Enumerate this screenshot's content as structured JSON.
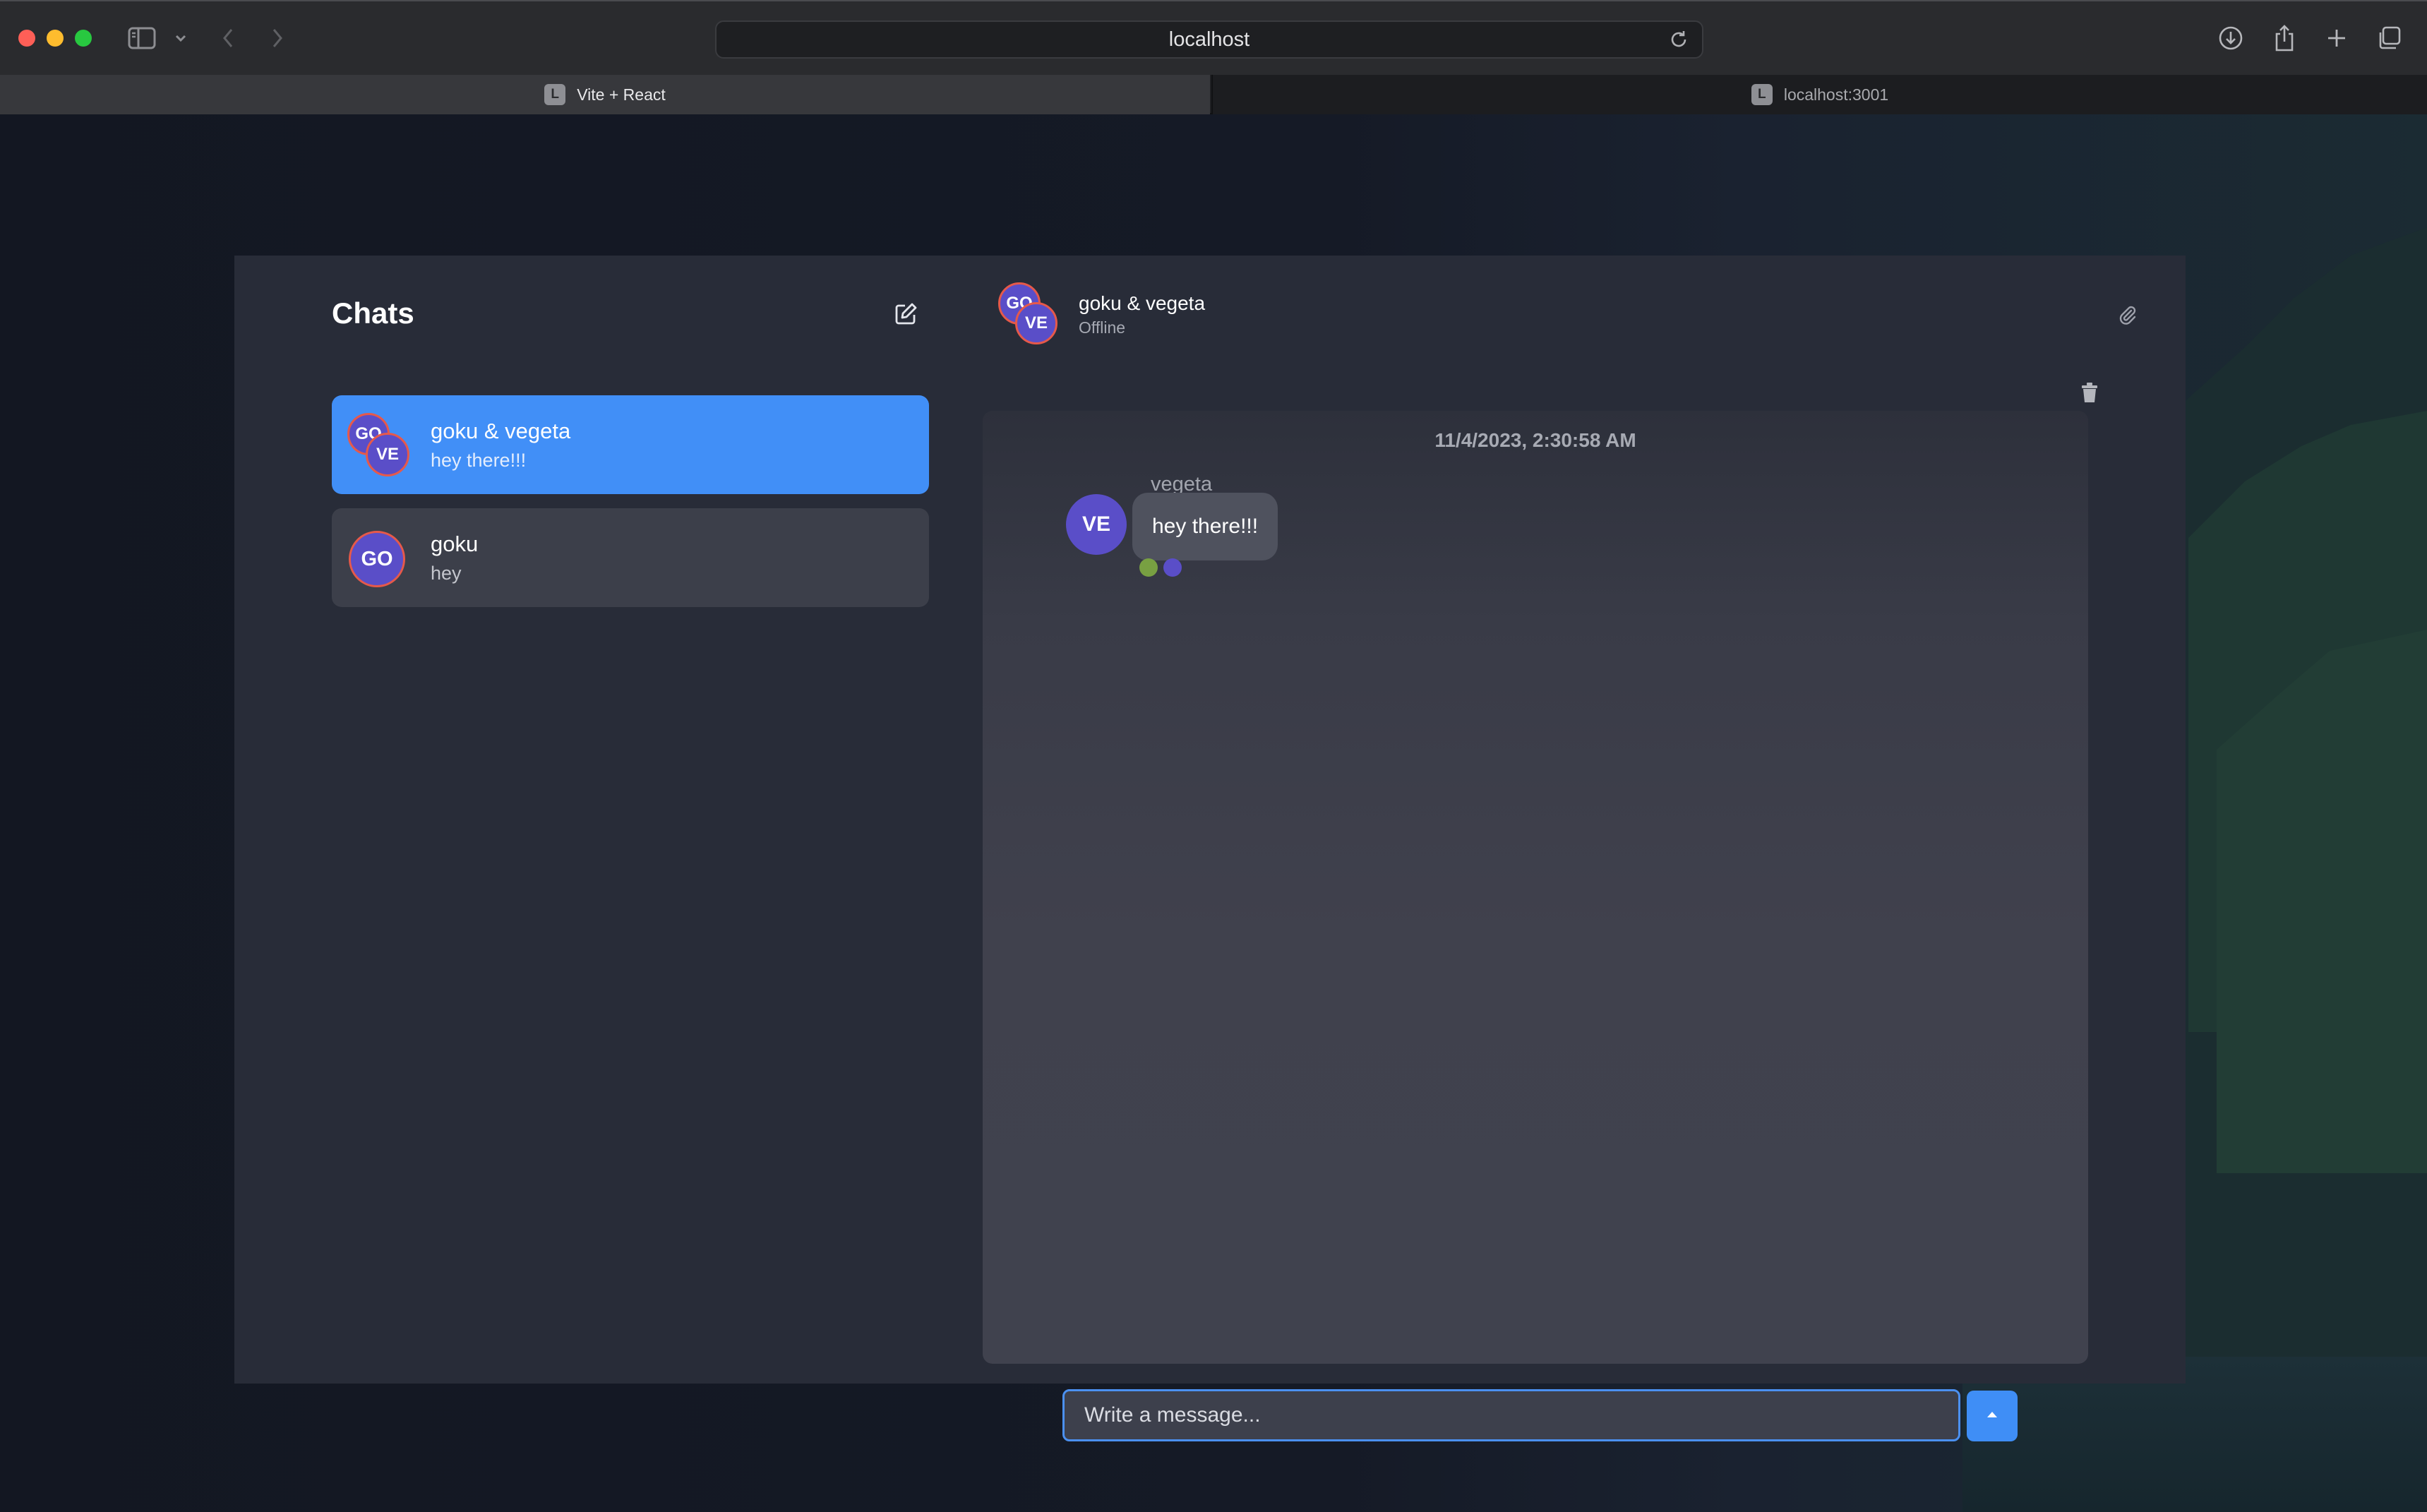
{
  "browser": {
    "url": "localhost",
    "tabs": [
      {
        "title": "Vite + React",
        "favicon": "L",
        "active": true
      },
      {
        "title": "localhost:3001",
        "favicon": "L",
        "active": false
      }
    ]
  },
  "sidebar": {
    "title": "Chats",
    "chats": [
      {
        "name": "goku & vegeta",
        "preview": "hey there!!!",
        "avatars": [
          "GO",
          "VE"
        ],
        "selected": true
      },
      {
        "name": "goku",
        "preview": "hey",
        "avatars": [
          "GO"
        ],
        "selected": false
      }
    ]
  },
  "conversation": {
    "title": "goku & vegeta",
    "status": "Offline",
    "header_avatars": [
      "GO",
      "VE"
    ],
    "messages": [
      {
        "date": "11/4/2023, 2:30:58 AM",
        "sender": "vegeta",
        "avatar": "VE",
        "text": "hey there!!!",
        "read_receipt_colors": [
          "#78a042",
          "#5a4ec8"
        ]
      }
    ],
    "composer": {
      "placeholder": "Write a message...",
      "value": ""
    }
  },
  "colors": {
    "accent": "#418ff7",
    "avatar": "#5a4ec8",
    "avatar_ring": "#e6594a",
    "panel": "#282c38"
  },
  "icons": {
    "compose": "pencil-square-icon",
    "attach": "paperclip-icon",
    "delete": "trash-icon",
    "send": "caret-up-icon"
  }
}
